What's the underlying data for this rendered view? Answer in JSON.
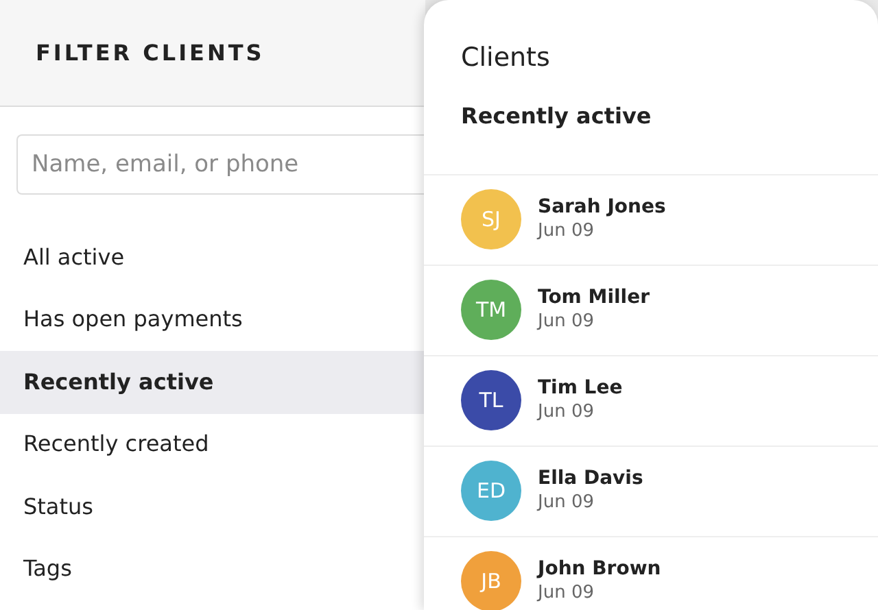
{
  "filter_panel": {
    "title": "FILTER CLIENTS",
    "search": {
      "placeholder": "Name, email, or phone"
    },
    "items": [
      {
        "label": "All active",
        "selected": false
      },
      {
        "label": "Has open payments",
        "selected": false
      },
      {
        "label": "Recently active",
        "selected": true
      },
      {
        "label": "Recently created",
        "selected": false
      },
      {
        "label": "Status",
        "selected": false
      },
      {
        "label": "Tags",
        "selected": false
      }
    ]
  },
  "clients_panel": {
    "title": "Clients",
    "subtitle": "Recently active",
    "clients": [
      {
        "initials": "SJ",
        "name": "Sarah Jones",
        "date": "Jun 09",
        "color": "#f2c14e"
      },
      {
        "initials": "TM",
        "name": "Tom Miller",
        "date": "Jun 09",
        "color": "#5fae5a"
      },
      {
        "initials": "TL",
        "name": "Tim Lee",
        "date": "Jun 09",
        "color": "#3b4ba8"
      },
      {
        "initials": "ED",
        "name": "Ella Davis",
        "date": "Jun 09",
        "color": "#4fb3cf"
      },
      {
        "initials": "JB",
        "name": "John Brown",
        "date": "Jun 09",
        "color": "#f0a03c"
      }
    ]
  }
}
